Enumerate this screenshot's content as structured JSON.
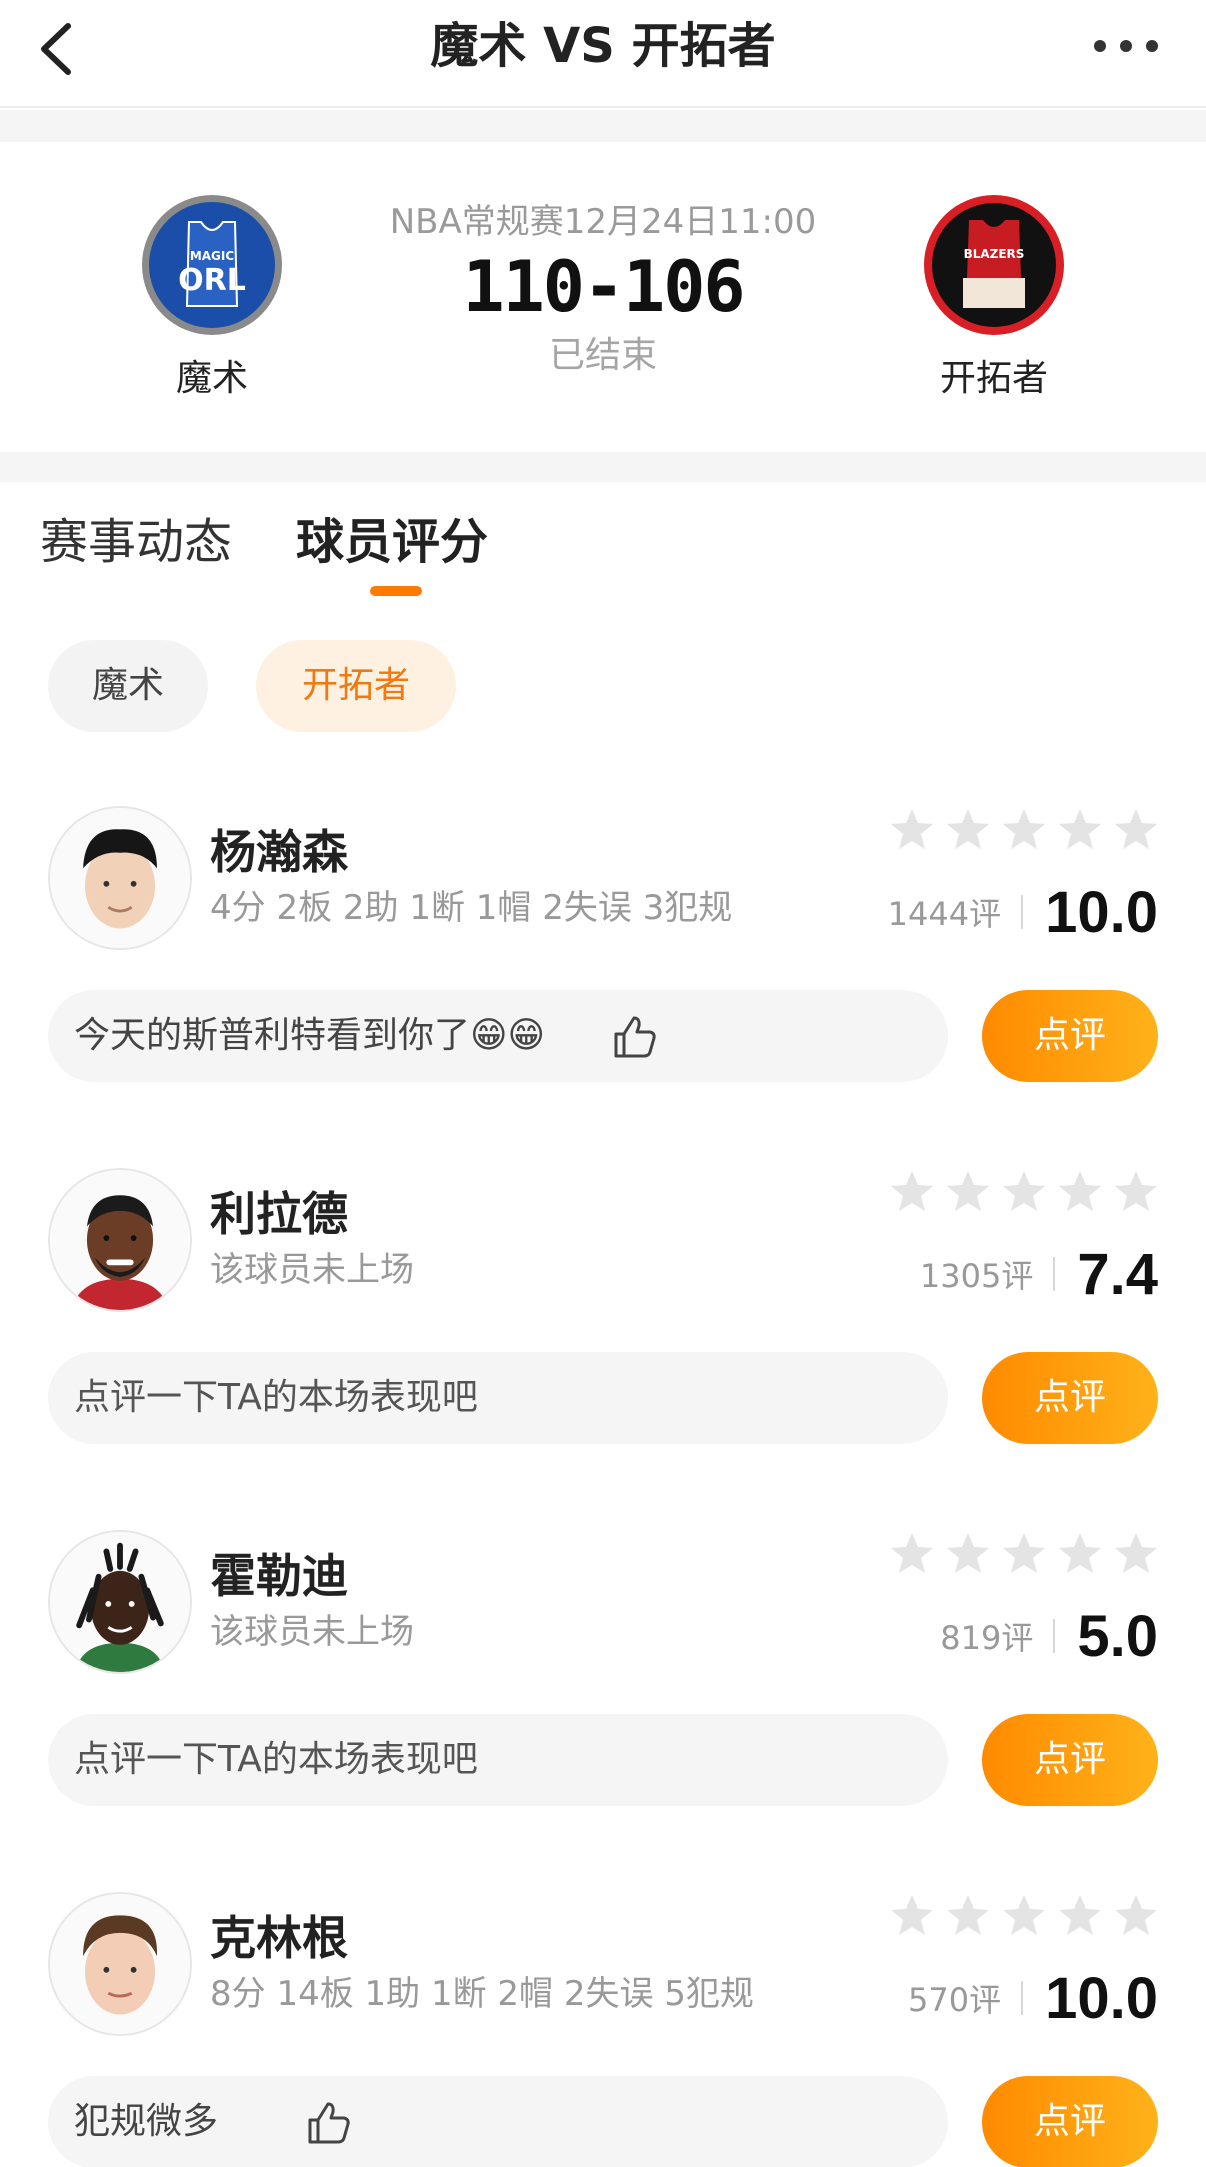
{
  "header": {
    "title": "魔术 VS 开拓者",
    "back_icon": "chevron-left-icon",
    "more_icon": "more-dots-icon"
  },
  "match": {
    "home": {
      "name": "魔术",
      "logo_text_top": "MAGIC",
      "logo_text": "ORL"
    },
    "away": {
      "name": "开拓者",
      "logo_text": "BLAZERS"
    },
    "info": "NBA常规赛12月24日11:00",
    "score": "110-106",
    "status": "已结束"
  },
  "tabs": [
    {
      "label": "赛事动态",
      "active": false
    },
    {
      "label": "球员评分",
      "active": true
    }
  ],
  "filters": [
    {
      "label": "魔术",
      "active": false
    },
    {
      "label": "开拓者",
      "active": true
    }
  ],
  "review_button_label": "点评",
  "players": [
    {
      "name": "杨瀚森",
      "stats": "4分 2板 2助 1断 1帽 2失误 3犯规",
      "rating_count": "1444评",
      "score": "10.0",
      "comment": "今天的斯普利特看到你了😁😁",
      "has_like": true
    },
    {
      "name": "利拉德",
      "stats": "该球员未上场",
      "rating_count": "1305评",
      "score": "7.4",
      "comment": "点评一下TA的本场表现吧",
      "has_like": false
    },
    {
      "name": "霍勒迪",
      "stats": "该球员未上场",
      "rating_count": "819评",
      "score": "5.0",
      "comment": "点评一下TA的本场表现吧",
      "has_like": false
    },
    {
      "name": "克林根",
      "stats": "8分 14板 1助 1断 2帽 2失误 5犯规",
      "rating_count": "570评",
      "score": "10.0",
      "comment": "犯规微多",
      "has_like": true
    }
  ],
  "colors": {
    "accent": "#ff8a00",
    "accent_light": "#fff1e2",
    "star": "#e4e4e4",
    "magic_blue": "#1a4ea8",
    "blazers_red": "#d81f26"
  }
}
